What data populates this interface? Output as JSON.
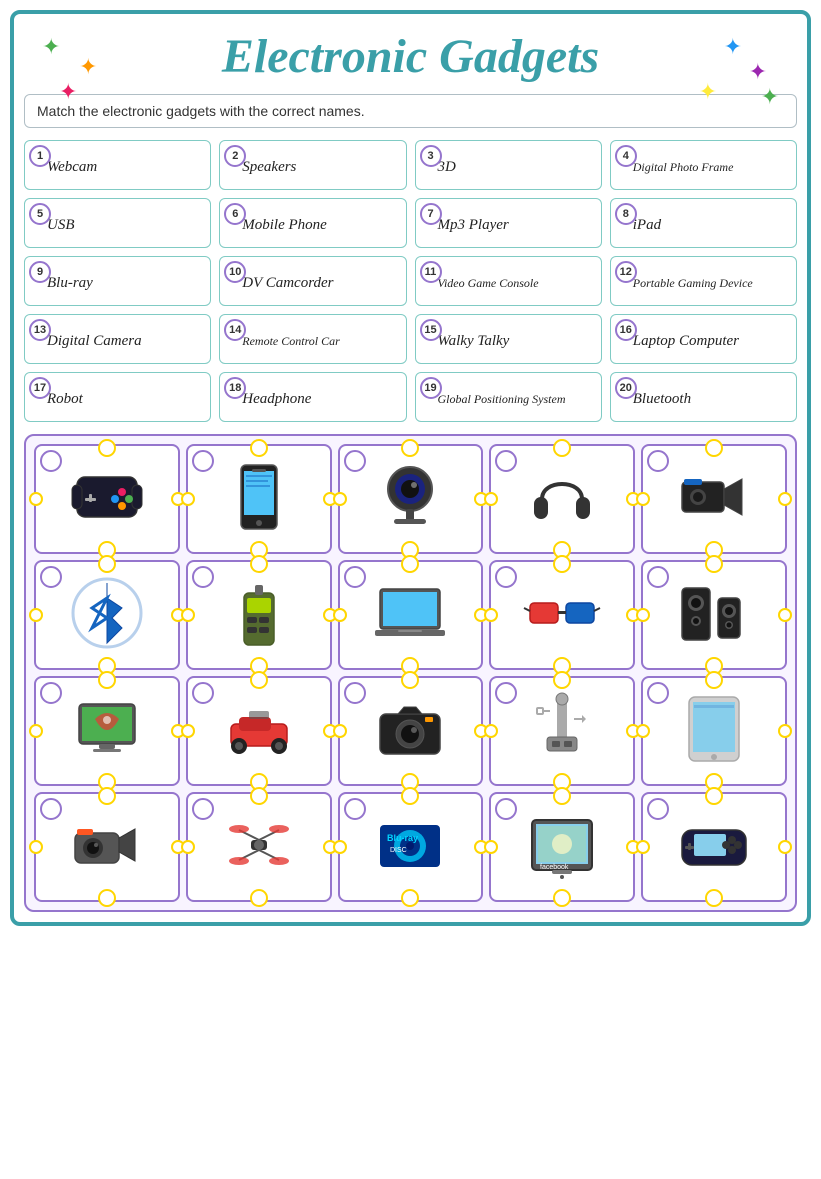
{
  "title": "Electronic Gadgets",
  "instruction": "Match the electronic gadgets with the correct names.",
  "labels": [
    {
      "num": 1,
      "text": "Webcam",
      "small": false
    },
    {
      "num": 2,
      "text": "Speakers",
      "small": false
    },
    {
      "num": 3,
      "text": "3D",
      "small": false
    },
    {
      "num": 4,
      "text": "Digital Photo Frame",
      "small": true
    },
    {
      "num": 5,
      "text": "USB",
      "small": false
    },
    {
      "num": 6,
      "text": "Mobile Phone",
      "small": false
    },
    {
      "num": 7,
      "text": "Mp3 Player",
      "small": false
    },
    {
      "num": 8,
      "text": "iPad",
      "small": false
    },
    {
      "num": 9,
      "text": "Blu-ray",
      "small": false
    },
    {
      "num": 10,
      "text": "DV Camcorder",
      "small": false
    },
    {
      "num": 11,
      "text": "Video Game Console",
      "small": true
    },
    {
      "num": 12,
      "text": "Portable Gaming Device",
      "small": true
    },
    {
      "num": 13,
      "text": "Digital Camera",
      "small": false
    },
    {
      "num": 14,
      "text": "Remote Control Car",
      "small": true
    },
    {
      "num": 15,
      "text": "Walky Talky",
      "small": false
    },
    {
      "num": 16,
      "text": "Laptop Computer",
      "small": false
    },
    {
      "num": 17,
      "text": "Robot",
      "small": false
    },
    {
      "num": 18,
      "text": "Headphone",
      "small": false
    },
    {
      "num": 19,
      "text": "Global Positioning System",
      "small": true
    },
    {
      "num": 20,
      "text": "Bluetooth",
      "small": false
    }
  ],
  "gadgets": [
    {
      "id": "a",
      "desc": "game-console"
    },
    {
      "id": "b",
      "desc": "mobile-phone"
    },
    {
      "id": "c",
      "desc": "webcam"
    },
    {
      "id": "d",
      "desc": "headphones"
    },
    {
      "id": "e",
      "desc": "dv-camcorder"
    },
    {
      "id": "f",
      "desc": "bluetooth"
    },
    {
      "id": "g",
      "desc": "walky-talky"
    },
    {
      "id": "h",
      "desc": "laptop"
    },
    {
      "id": "i",
      "desc": "3d-glasses"
    },
    {
      "id": "j",
      "desc": "speakers"
    },
    {
      "id": "k",
      "desc": "gps"
    },
    {
      "id": "l",
      "desc": "remote-car"
    },
    {
      "id": "m",
      "desc": "digital-camera"
    },
    {
      "id": "n",
      "desc": "usb"
    },
    {
      "id": "o",
      "desc": "ipad"
    },
    {
      "id": "p",
      "desc": "video-camera"
    },
    {
      "id": "q",
      "desc": "drone-rc"
    },
    {
      "id": "r",
      "desc": "blu-ray"
    },
    {
      "id": "s",
      "desc": "digital-photo-frame"
    },
    {
      "id": "t",
      "desc": "psp"
    }
  ],
  "colors": {
    "title": "#3a9fa8",
    "border": "#3a9fa8",
    "label_border": "#80cbc4",
    "num_border": "#9575cd",
    "img_border": "#9575cd",
    "dot_border": "#ffd600"
  }
}
